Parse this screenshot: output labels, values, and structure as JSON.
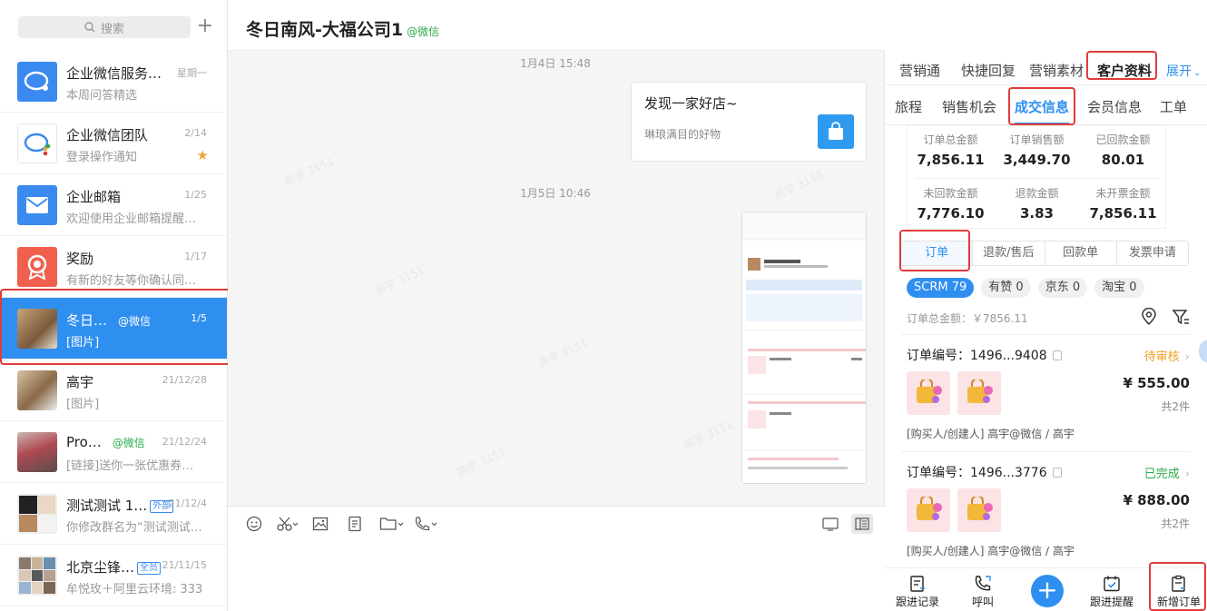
{
  "sidebar": {
    "search_placeholder": "搜索",
    "add_symbol": "+",
    "conversations": [
      {
        "name": "企业微信服务…",
        "date": "星期一",
        "preview": "本周问答精选",
        "avatar": "qywx-service-logo"
      },
      {
        "name": "企业微信团队",
        "date": "2/14",
        "preview": "登录操作通知",
        "avatar": "qywx-team-logo",
        "starred": true
      },
      {
        "name": "企业邮箱",
        "date": "1/25",
        "preview": "欢迎使用企业邮箱提醒…",
        "avatar": "mail-logo"
      },
      {
        "name": "奖励",
        "date": "1/17",
        "preview": "有新的好友等你确认同…",
        "avatar": "reward-logo"
      },
      {
        "name": "冬日…",
        "tag": "@微信",
        "date": "1/5",
        "preview": "[图片]",
        "avatar": "photo",
        "active": true
      },
      {
        "name": "高宇",
        "date": "21/12/28",
        "preview": "[图片]",
        "avatar": "photo"
      },
      {
        "name": "Pro…",
        "tag": "@微信",
        "date": "21/12/24",
        "preview": "[链接]送你一张优惠券，…",
        "avatar": "photo"
      },
      {
        "name": "测试测试 1…",
        "badge": "外部",
        "date": "21/12/4",
        "preview": "你修改群名为“测试测试…",
        "avatar": "group"
      },
      {
        "name": "北京尘锋…",
        "badge": "全员",
        "date": "21/11/15",
        "preview": "牟悦玫＋阿里云环境: 333",
        "avatar": "group"
      }
    ]
  },
  "chat": {
    "title": "冬日南风-大福公司1",
    "title_tag": "@微信",
    "time1": "1月4日 15:48",
    "time2": "1月5日 10:46",
    "card": {
      "title": "发现一家好店~",
      "desc": "琳琅满目的好物"
    },
    "watermark": "高宇 3151"
  },
  "panel": {
    "tabs1": [
      "营销通",
      "快捷回复",
      "营销素材",
      "客户资料",
      "展开"
    ],
    "tabs2": [
      "旅程",
      "销售机会",
      "成交信息",
      "会员信息",
      "工单"
    ],
    "stats": [
      {
        "label": "订单总金额",
        "value": "7,856.11"
      },
      {
        "label": "订单销售额",
        "value": "3,449.70"
      },
      {
        "label": "已回款金额",
        "value": "80.01"
      },
      {
        "label": "未回款金额",
        "value": "7,776.10"
      },
      {
        "label": "退款金额",
        "value": "3.83"
      },
      {
        "label": "未开票金额",
        "value": "7,856.11"
      }
    ],
    "subtabs": [
      "订单",
      "退款/售后",
      "回款单",
      "发票申请"
    ],
    "chips": [
      {
        "name": "SCRM",
        "count": "79"
      },
      {
        "name": "有赞",
        "count": "0"
      },
      {
        "name": "京东",
        "count": "0"
      },
      {
        "name": "淘宝",
        "count": "0"
      }
    ],
    "total_line": "订单总金额：￥7856.11",
    "orders": [
      {
        "number": "订单编号：1496...9408",
        "status": "待审核",
        "status_color": "#f0a020",
        "price": "¥ 555.00",
        "count": "共2件",
        "buyer": "[购买人/创建人] 高宇@微信 / 高宇"
      },
      {
        "number": "订单编号：1496...3776",
        "status": "已完成",
        "status_color": "#2bab4a",
        "price": "¥ 888.00",
        "count": "共2件",
        "buyer": "[购买人/创建人] 高宇@微信 / 高宇"
      }
    ],
    "bottom": [
      "跟进记录",
      "呼叫",
      "跟进提醒",
      "新增订单"
    ]
  },
  "colors": {
    "accent": "#2f8ff0",
    "highlight": "#e23b3b",
    "wechat_green": "#2bab4a"
  }
}
